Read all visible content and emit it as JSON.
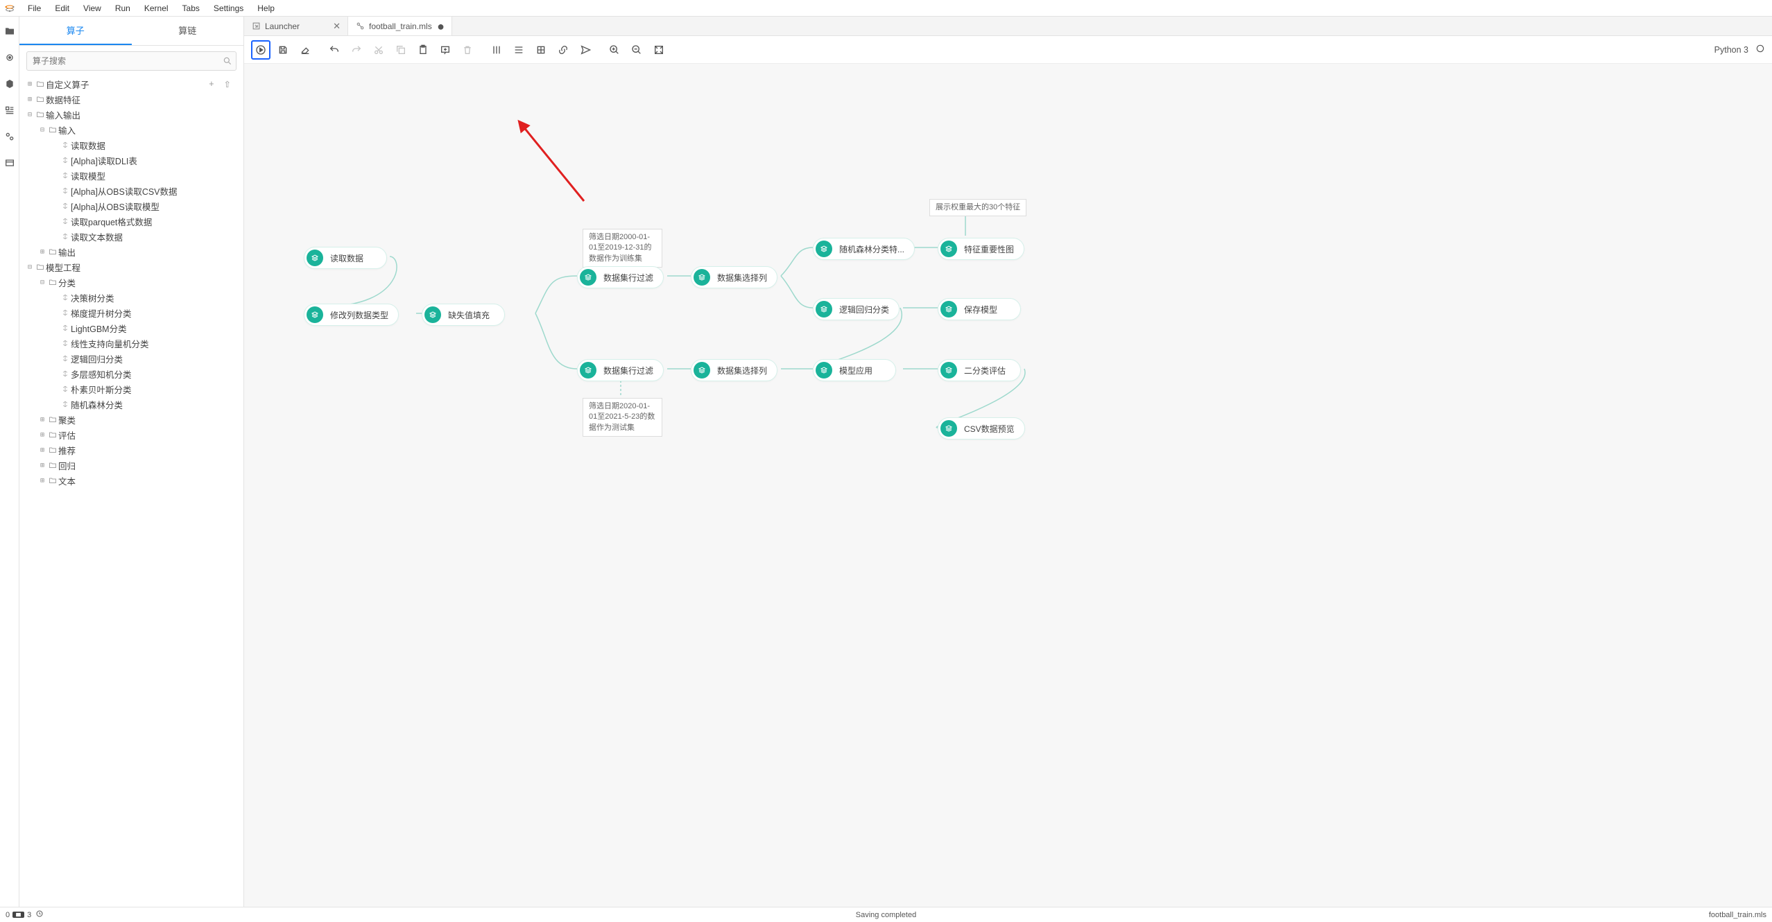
{
  "menu": [
    "File",
    "Edit",
    "View",
    "Run",
    "Kernel",
    "Tabs",
    "Settings",
    "Help"
  ],
  "left_tabs": {
    "op": "算子",
    "chain": "算链"
  },
  "search_placeholder": "算子搜索",
  "tree": {
    "custom": "自定义算子",
    "feat": "数据特征",
    "io": "输入输出",
    "input": "输入",
    "in_items": [
      "读取数据",
      "[Alpha]读取DLI表",
      "读取模型",
      "[Alpha]从OBS读取CSV数据",
      "[Alpha]从OBS读取模型",
      "读取parquet格式数据",
      "读取文本数据"
    ],
    "output": "输出",
    "me": "模型工程",
    "cls": "分类",
    "cls_items": [
      "决策树分类",
      "梯度提升树分类",
      "LightGBM分类",
      "线性支持向量机分类",
      "逻辑回归分类",
      "多层感知机分类",
      "朴素贝叶斯分类",
      "随机森林分类"
    ],
    "cluster": "聚类",
    "eval": "评估",
    "rec": "推荐",
    "reg": "回归",
    "txt": "文本"
  },
  "tabs": {
    "launcher": "Launcher",
    "file": "football_train.mls"
  },
  "kernel_name": "Python 3",
  "comments": {
    "top1": "展示权重最大的30个特征",
    "train": "筛选日期2000-01-01至2019-12-31的数据作为训练集",
    "test": "筛选日期2020-01-01至2021-5-23的数据作为测试集"
  },
  "nodes": {
    "read": "读取数据",
    "chtype": "修改列数据类型",
    "fillna": "缺失值填充",
    "rowfilter1": "数据集行过滤",
    "colsel1": "数据集选择列",
    "rf": "随机森林分类特...",
    "featimp": "特征重要性图",
    "lr": "逻辑回归分类",
    "save": "保存模型",
    "rowfilter2": "数据集行过滤",
    "colsel2": "数据集选择列",
    "apply": "模型应用",
    "bineval": "二分类评估",
    "csv": "CSV数据预览"
  },
  "status": {
    "zero": "0",
    "count": "3",
    "msg": "Saving completed",
    "file": "football_train.mls"
  }
}
